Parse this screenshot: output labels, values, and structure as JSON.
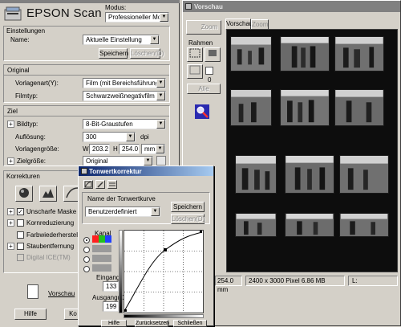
{
  "scan_window": {
    "titlebar": "EPSON Scan",
    "logo_text": "EPSON Scan",
    "modus_label": "Modus:",
    "modus_value": "Professioneller Modus",
    "einstellungen": {
      "header": "Einstellungen",
      "name_label": "Name:",
      "name_value": "Aktuelle Einstellung",
      "speichern": "Speichern",
      "loeschen": "Löschen(D)"
    },
    "original": {
      "header": "Original",
      "vorlagenart_label": "Vorlagenart(Y):",
      "vorlagenart_value": "Film (mit Bereichsführung)",
      "filmtyp_label": "Filmtyp:",
      "filmtyp_value": "Schwarzweißnegativfilm"
    },
    "ziel": {
      "header": "Ziel",
      "bildtyp_label": "Bildtyp:",
      "bildtyp_value": "8-Bit-Graustufen",
      "aufloesung_label": "Auflösung:",
      "aufloesung_value": "300",
      "aufloesung_unit": "dpi",
      "vorlagengroesse_label": "Vorlagengröße:",
      "w_label": "W",
      "w_value": "203.2",
      "h_label": "H",
      "h_value": "254.0",
      "unit_value": "mm",
      "zielgroesse_label": "Zielgröße:",
      "zielgroesse_value": "Original"
    },
    "korrekturen": {
      "header": "Korrekturen",
      "unscharfe_maske": "Unscharfe Maske",
      "unscharfe_checked": true,
      "kornreduzierung": "Kornreduzierung",
      "farbwiederherstellung": "Farbwiederherstellung",
      "staubentfernung": "Staubentfernung",
      "digital_ice": "Digital ICE(TM)"
    },
    "vorschau_label": "Vorschau",
    "hilfe": "Hilfe",
    "konfig_partial": "Ko"
  },
  "preview_window": {
    "title": "Vorschau",
    "zoom_button": "Zoom",
    "tab_vorschau": "Vorschau",
    "tab_zoom": "Zoom",
    "rahmen_label": "Rahmen",
    "frame_counter": "0",
    "alle_button": "Alle",
    "status_size": "254.0 mm",
    "status_pixels": "2400 x 3000 Pixel 6.86 MB",
    "status_l": "L:"
  },
  "tonwert_dialog": {
    "title": "Tonwertkorrektur",
    "kurve_label": "Name der Tonwertkurve",
    "kurve_value": "Benutzerdefiniert",
    "speichern": "Speichern",
    "loeschen": "Löschen(D)",
    "kanal_label": "Kanal",
    "eingang_label": "Eingang:",
    "eingang_value": "133",
    "ausgang_label": "Ausgang(O):",
    "ausgang_value": "199",
    "hilfe": "Hilfe",
    "zuruecksetzen": "Zurücksetzen",
    "schliessen": "Schließen"
  },
  "colors": {
    "titlebar_active": "#0a246a",
    "titlebar_inactive": "#808080",
    "face": "#d4d0c8",
    "film_black": "#0d0d0d"
  }
}
